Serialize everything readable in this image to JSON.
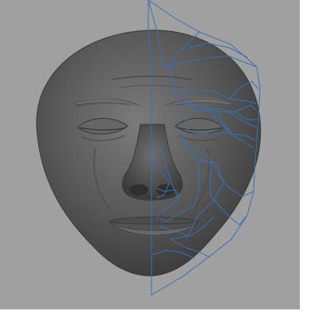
{
  "viewport": {
    "background": "#a0a0a0",
    "frame_background": "#ffffff"
  },
  "mesh": {
    "subject": "sculpted-head-model",
    "shading_color": "#5c5c5c",
    "wireframe_color": "#3a6fb6"
  }
}
